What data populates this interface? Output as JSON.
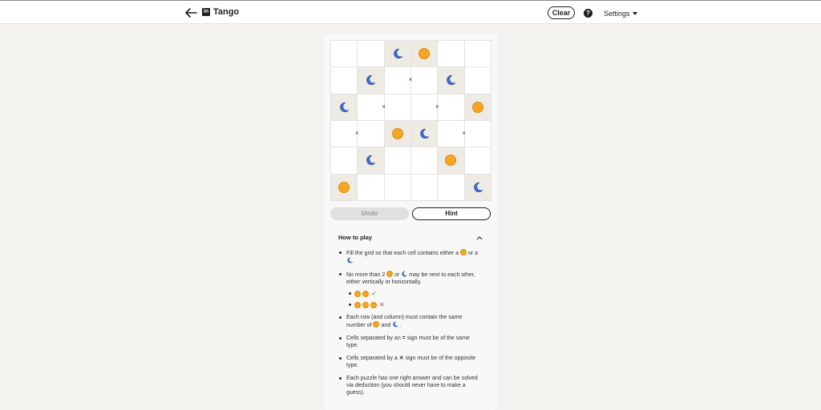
{
  "header": {
    "title": "Tango",
    "logo_text": "in",
    "clear_label": "Clear",
    "help_label": "?",
    "settings_label": "Settings"
  },
  "board": {
    "size": 6,
    "cells": [
      [
        "",
        "",
        "moon",
        "sun",
        "",
        ""
      ],
      [
        "",
        "moon",
        "",
        "",
        "moon",
        ""
      ],
      [
        "moon",
        "",
        "",
        "",
        "",
        "sun"
      ],
      [
        "",
        "",
        "sun",
        "moon",
        "",
        ""
      ],
      [
        "",
        "moon",
        "",
        "",
        "sun",
        ""
      ],
      [
        "sun",
        "",
        "",
        "",
        "",
        "moon"
      ]
    ],
    "locked": [
      [
        false,
        false,
        true,
        true,
        false,
        false
      ],
      [
        false,
        true,
        false,
        false,
        true,
        false
      ],
      [
        true,
        false,
        false,
        false,
        false,
        true
      ],
      [
        false,
        false,
        true,
        true,
        false,
        false
      ],
      [
        false,
        true,
        false,
        false,
        true,
        false
      ],
      [
        true,
        false,
        false,
        false,
        false,
        true
      ]
    ],
    "constraints": [
      {
        "row": 1,
        "col": 2,
        "side": "right",
        "symbol": "×"
      },
      {
        "row": 2,
        "col": 1,
        "side": "right",
        "symbol": "×"
      },
      {
        "row": 2,
        "col": 3,
        "side": "right",
        "symbol": "×"
      },
      {
        "row": 3,
        "col": 0,
        "side": "right",
        "symbol": "×"
      },
      {
        "row": 3,
        "col": 4,
        "side": "right",
        "symbol": "×"
      }
    ]
  },
  "buttons": {
    "undo_label": "Undo",
    "hint_label": "Hint"
  },
  "how_to_play": {
    "title": "How to play",
    "rule1_a": "Fill the grid so that each cell contains either a",
    "rule1_b": "or",
    "rule1_c": "a",
    "rule1_d": ".",
    "rule2_a": "No more than 2",
    "rule2_b": "or",
    "rule2_c": "may be next to each other, either vertically or horizontally.",
    "check": "✓",
    "cross": "✕",
    "rule3_a": "Each row (and column) must contain the same number of",
    "rule3_b": "and",
    "rule3_c": ".",
    "rule4_a": "Cells separated by an",
    "rule4_b": "=",
    "rule4_c": "sign must be of the same type.",
    "rule5_a": "Cells separated by a",
    "rule5_b": "✕",
    "rule5_c": "sign must be of the opposite type.",
    "rule6": "Each puzzle has one right answer and can be solved via deduction (you should never have to make a guess)."
  },
  "colors": {
    "sun": "#f5a623",
    "moon": "#3f6fd8",
    "locked_cell": "#eeeae4"
  },
  "icons": {
    "back": "arrow-left-icon",
    "help": "question-circle-icon",
    "settings": "caret-down-icon",
    "collapse": "chevron-up-icon"
  }
}
